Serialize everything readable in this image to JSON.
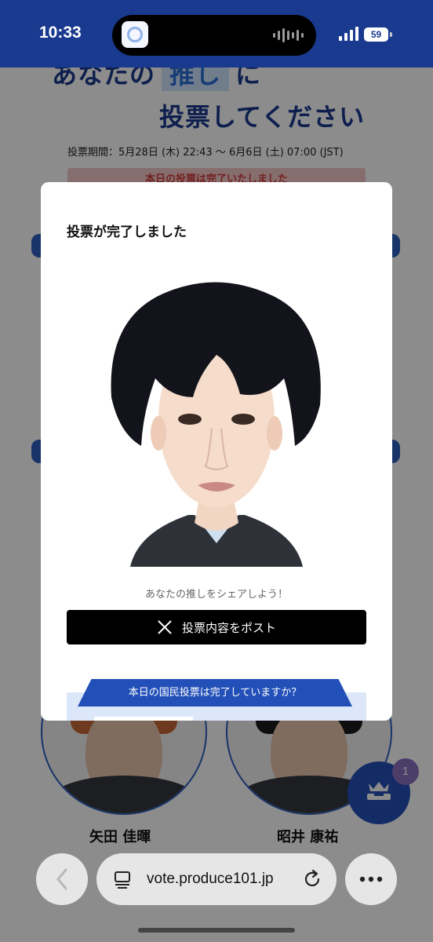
{
  "status_bar": {
    "time": "10:33",
    "battery": "59",
    "bg_color": "#1a3a8f"
  },
  "page": {
    "headline_part1": "あなたの",
    "headline_highlight": "推し",
    "headline_part2": "に",
    "headline_line2": "投票してください",
    "voting_period": "投票期間：5月28日 (木) 22:43 〜 6月6日 (土) 07:00 (JST)",
    "done_banner": "本日の投票は完了いたしました",
    "candidates": [
      {
        "name": "矢田 佳暉",
        "hair_color": "#c96a3a"
      },
      {
        "name": "昭井 康祐",
        "hair_color": "#1a1a1a"
      }
    ],
    "vote_box_icon": "crown-ballot-box-icon",
    "vote_count_badge": "1"
  },
  "modal": {
    "title": "投票が完了しました",
    "share_caption": "あなたの推しをシェアしよう！",
    "post_button_label": "投票内容をポスト",
    "post_button_icon": "x-logo-icon",
    "promo_ribbon": "本日の国民投票は完了していますか？"
  },
  "browser": {
    "url": "vote.produce101.jp",
    "back_icon": "chevron-left-icon",
    "tabs_icon": "tabs-icon",
    "reload_icon": "reload-icon",
    "more_icon": "ellipsis-icon"
  },
  "colors": {
    "brand_blue": "#1a3a8f",
    "accent_blue": "#2350b8",
    "post_button": "#000000"
  }
}
